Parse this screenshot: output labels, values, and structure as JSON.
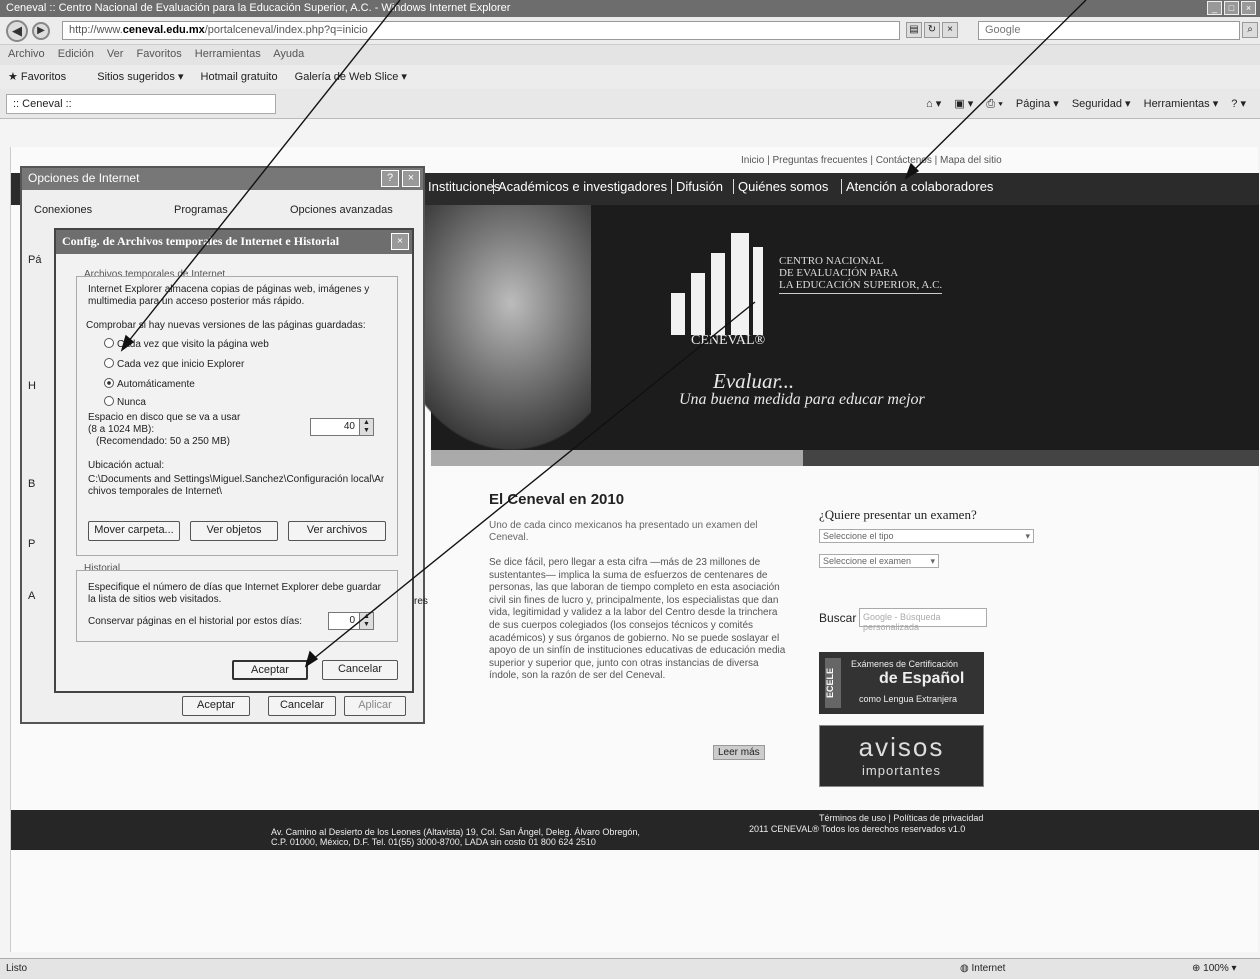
{
  "browser": {
    "title": "Ceneval :: Centro Nacional de Evaluación para la Educación Superior, A.C. - Windows Internet Explorer",
    "url_prefix": "http://www.",
    "url_domain": "ceneval.edu.mx",
    "url_rest": "/portalceneval/index.php?q=inicio",
    "search_placeholder": "Google",
    "menu": [
      "Archivo",
      "Edición",
      "Ver",
      "Favoritos",
      "Herramientas",
      "Ayuda"
    ],
    "favorites_label": "Favoritos",
    "fav_items": [
      "Sitios sugeridos ▾",
      "Hotmail gratuito",
      "Galería de Web Slice ▾"
    ],
    "tab_title": ":: Ceneval ::",
    "cmd_items": [
      "Página ▾",
      "Seguridad ▾",
      "Herramientas ▾"
    ],
    "status_left": "Listo",
    "status_zone": "Internet",
    "status_zoom": "100%"
  },
  "site": {
    "top_links": "Inicio | Preguntas frecuentes | Contáctenos | Mapa del sitio",
    "nav": [
      "Instituciones",
      "Académicos e investigadores",
      "Difusión",
      "Quiénes somos",
      "Atención a colaboradores"
    ],
    "logo_lines": [
      "CENTRO NACIONAL",
      "DE EVALUACIÓN PARA",
      "LA EDUCACIÓN SUPERIOR, A.C."
    ],
    "logo_word": "CENEVAL®",
    "slogan_1": "Evaluar...",
    "slogan_2": "Una buena medida para educar mejor",
    "news_title": "El Ceneval en 2010",
    "news_intro": "Uno de cada cinco mexicanos ha presentado un examen del Ceneval.",
    "news_body": "Se dice fácil, pero llegar a esta cifra —más de 23 millones de sustentantes— implica la suma de esfuerzos de centenares de personas, las que laboran de tiempo completo en esta asociación civil sin fines de lucro y, principalmente, los especialistas que dan vida, legitimidad y validez a la labor del Centro desde la trinchera de sus cuerpos colegiados (los consejos técnicos y comités académicos) y sus órganos de gobierno. No se puede soslayar el apoyo de un sinfín de instituciones educativas de educación media superior y superior que, junto con otras instancias de diversa índole, son la razón de ser del Ceneval.",
    "more_link": "Leer más",
    "exam_title": "¿Quiere presentar un examen?",
    "exam_select_1": "Seleccione el tipo",
    "exam_select_2": "Seleccione el examen",
    "buscar_label": "Buscar",
    "buscar_placeholder": "Google - Búsqueda personalizada",
    "ecele_side": "ECELE",
    "ecele_1": "Exámenes de Certificación",
    "ecele_2": "de Español",
    "ecele_3": "como Lengua Extranjera",
    "avisos_1": "avisos",
    "avisos_2": "importantes",
    "footer_terms": "Términos de uso | Políticas de privacidad",
    "footer_copy": "2011 CENEVAL® Todos los derechos reservados v1.0",
    "footer_address_1": "Av. Camino al Desierto de los Leones (Altavista) 19, Col. San Ángel, Deleg. Álvaro Obregón,",
    "footer_address_2": "C.P. 01000, México, D.F. Tel. 01(55) 3000-8700, LADA sin costo 01 800 624 2510"
  },
  "options_dialog": {
    "title": "Opciones de Internet",
    "tabs": [
      "Conexiones",
      "Programas",
      "Opciones avanzadas"
    ],
    "side_chars": [
      "Pá",
      "H",
      "B",
      "P",
      "A"
    ],
    "btn_ok": "Aceptar",
    "btn_cancel": "Cancelar",
    "btn_apply": "Aplicar",
    "peek_text": "res"
  },
  "cfg_dialog": {
    "title": "Config. de Archivos temporales de Internet e Historial",
    "temp_group": "Archivos temporales de Internet",
    "temp_desc": "Internet Explorer almacena copias de páginas web, imágenes y multimedia para un acceso posterior más rápido.",
    "check_label": "Comprobar si hay nuevas versiones de las páginas guardadas:",
    "radio_1": "Cada vez que visito la página web",
    "radio_2": "Cada vez que inicio Explorer",
    "radio_3": "Automáticamente",
    "radio_4": "Nunca",
    "disk_label_1": "Espacio en disco que se va a usar",
    "disk_label_2": "(8 a 1024 MB):",
    "disk_label_3": "(Recomendado: 50 a 250 MB)",
    "disk_value": "40",
    "loc_label": "Ubicación actual:",
    "loc_value": "C:\\Documents and Settings\\Miguel.Sanchez\\Configuración local\\Archivos temporales de Internet\\",
    "btn_move": "Mover carpeta...",
    "btn_objects": "Ver objetos",
    "btn_files": "Ver archivos",
    "hist_group": "Historial",
    "hist_desc": "Especifique el número de días que Internet Explorer debe guardar la lista de sitios web visitados.",
    "days_label": "Conservar páginas en el historial por estos días:",
    "days_value": "0",
    "btn_ok": "Aceptar",
    "btn_cancel": "Cancelar"
  }
}
